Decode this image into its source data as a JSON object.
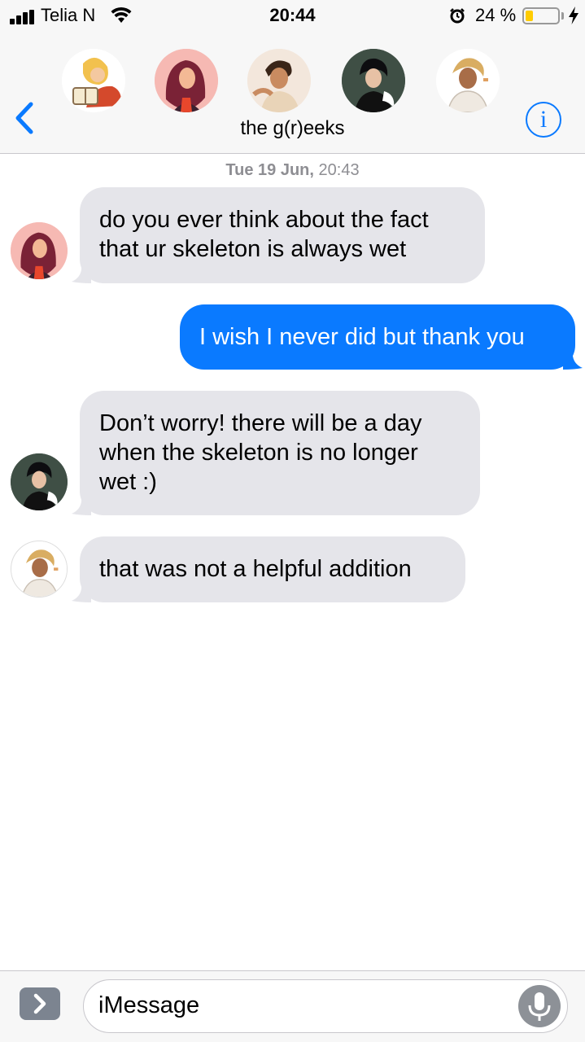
{
  "status_bar": {
    "carrier": "Telia N",
    "time": "20:44",
    "battery_percent": "24 %",
    "battery_level": 0.24,
    "battery_color": "#ffcc00"
  },
  "header": {
    "title": "the g(r)eeks",
    "back_icon": "chevron-left-icon",
    "info_icon": "info-icon",
    "info_glyph": "i",
    "accent_color": "#0a7aff"
  },
  "conversation": {
    "timestamp_day": "Tue 19 Jun,",
    "timestamp_time": "20:43",
    "messages": [
      {
        "direction": "received",
        "lines": [
          "do you ever think about the fact",
          "that ur skeleton is always wet"
        ]
      },
      {
        "direction": "sent",
        "lines": [
          "I wish I never did but thank you"
        ]
      },
      {
        "direction": "received",
        "lines": [
          "Don’t worry! there will be a day",
          "when the skeleton is no longer",
          "wet :)"
        ]
      },
      {
        "direction": "received",
        "lines": [
          "that was not a helpful addition"
        ]
      }
    ]
  },
  "composer": {
    "placeholder": "iMessage",
    "apps_icon": "chevron-right-icon",
    "mic_icon": "microphone-icon"
  }
}
